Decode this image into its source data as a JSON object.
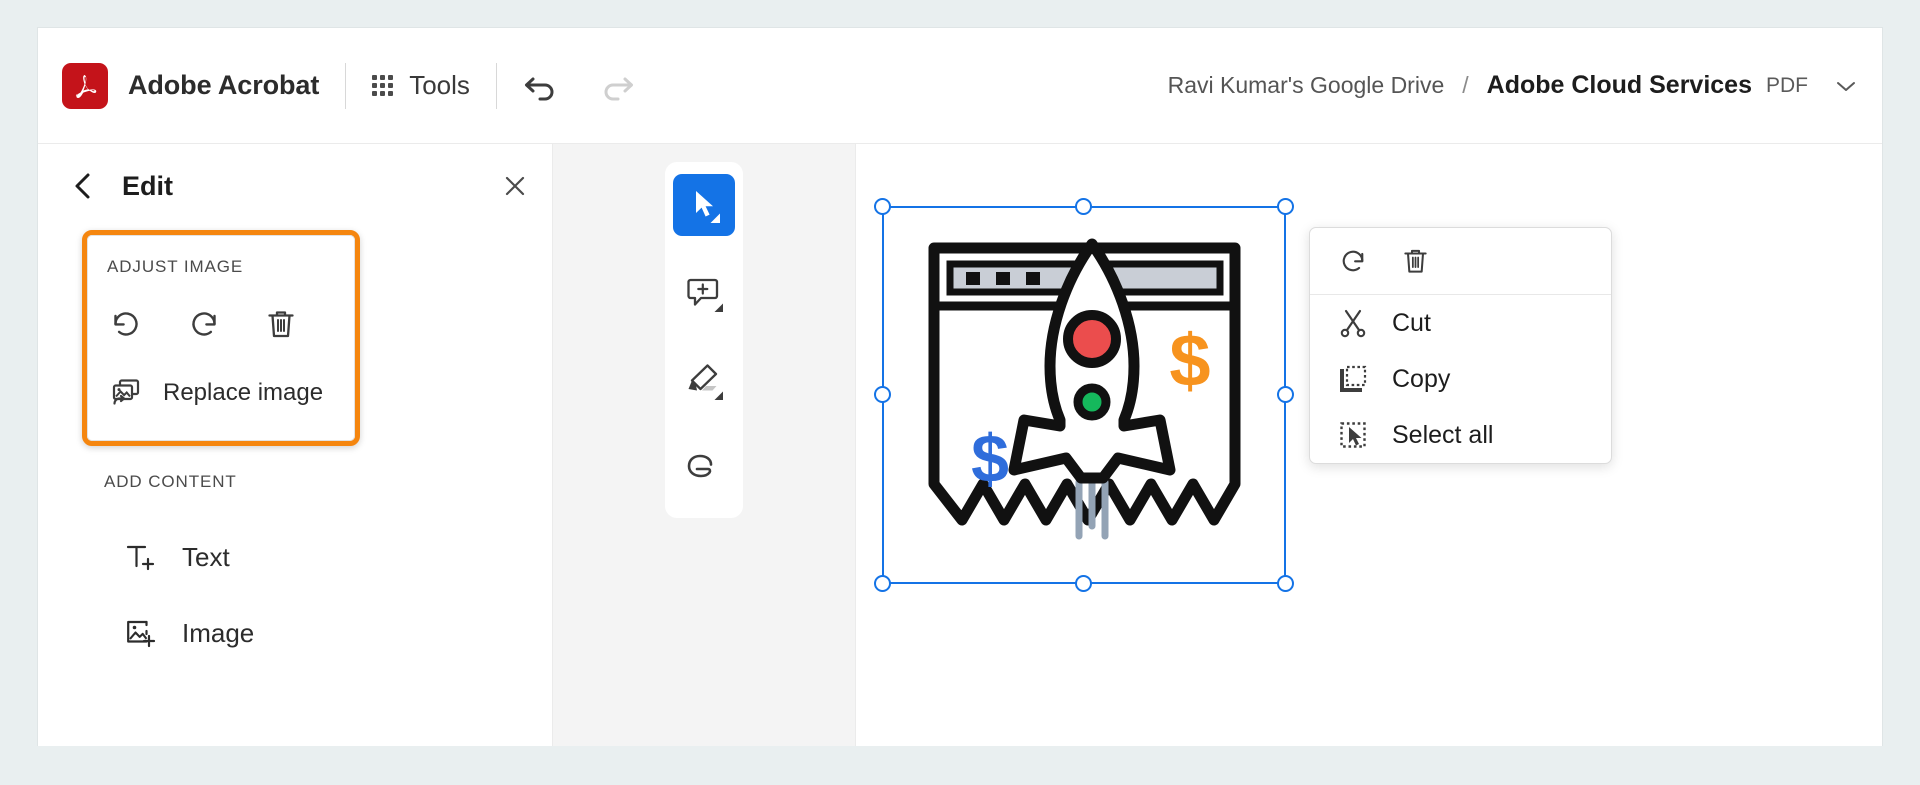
{
  "app": {
    "logo_icon": "acrobat-logo-icon",
    "title": "Adobe Acrobat",
    "brand_color": "#c4131a"
  },
  "toolbar": {
    "tools_label": "Tools",
    "tools_icon": "grid-apps-icon",
    "undo_icon": "undo-arrow-icon",
    "redo_icon": "redo-arrow-icon",
    "undo_enabled": "true",
    "redo_enabled": "false"
  },
  "breadcrumb": {
    "parent": "Ravi Kumar's Google Drive",
    "separator": "/",
    "current": "Adobe Cloud Services",
    "file_type": "PDF",
    "caret_icon": "chevron-down-icon"
  },
  "sidebar": {
    "back_icon": "chevron-left-icon",
    "title": "Edit",
    "close_icon": "close-x-icon",
    "adjust_image": {
      "section_label": "Adjust image",
      "highlight_color": "#f5860f",
      "actions": [
        {
          "icon": "rotate-left-icon",
          "name": "rotate-counterclockwise"
        },
        {
          "icon": "rotate-right-icon",
          "name": "rotate-clockwise"
        },
        {
          "icon": "trash-icon",
          "name": "delete-image"
        }
      ],
      "replace_label": "Replace image",
      "replace_icon": "replace-image-icon"
    },
    "add_content": {
      "section_label": "Add content",
      "items": [
        {
          "label": "Text",
          "icon": "add-text-icon"
        },
        {
          "label": "Image",
          "icon": "add-image-icon"
        }
      ]
    }
  },
  "toolstrip": {
    "active_color": "#1473e6",
    "tools": [
      {
        "name": "select-tool",
        "icon": "cursor-arrow-icon",
        "active": "true"
      },
      {
        "name": "comment-tool",
        "icon": "add-comment-icon",
        "active": "false"
      },
      {
        "name": "highlight-tool",
        "icon": "highlighter-pen-icon",
        "active": "false"
      },
      {
        "name": "draw-tool",
        "icon": "lasso-loop-icon",
        "active": "false"
      }
    ]
  },
  "canvas": {
    "selection_color": "#1473e6",
    "image": {
      "name": "rocket-receipt-illustration",
      "colors": {
        "rocket_window_top": "#eb4d4d",
        "rocket_window_bottom": "#15b85c",
        "dollar_orange": "#f7931e",
        "dollar_blue": "#2f6ddb",
        "browser_bar": "#c9ced6",
        "exhaust": "#93a3b5"
      }
    }
  },
  "context_menu": {
    "top_actions": [
      {
        "name": "rotate-clockwise",
        "icon": "rotate-right-icon"
      },
      {
        "name": "delete",
        "icon": "trash-icon"
      }
    ],
    "items": [
      {
        "label": "Cut",
        "icon": "scissors-icon"
      },
      {
        "label": "Copy",
        "icon": "copy-icon"
      },
      {
        "label": "Select all",
        "icon": "select-all-icon"
      }
    ]
  }
}
